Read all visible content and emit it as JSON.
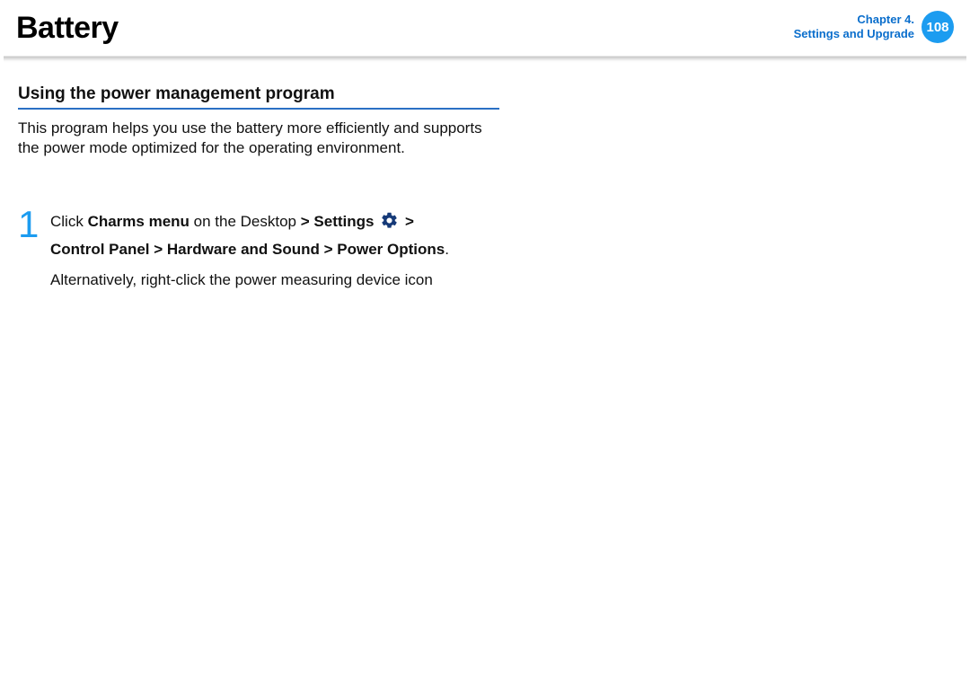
{
  "header": {
    "title": "Battery",
    "chapter_line1": "Chapter 4.",
    "chapter_line2": "Settings and Upgrade",
    "page_number": "108"
  },
  "section": {
    "heading": "Using the power management program",
    "intro": "This program helps you use the battery more efficiently and supports the power mode optimized for the operating environment."
  },
  "step": {
    "number": "1",
    "click_text": "Click ",
    "charms_menu": "Charms menu",
    "on_desktop": " on the Desktop ",
    "gt1": "> ",
    "settings": "Settings",
    "gt2": " > ",
    "control_panel": "Control Panel > Hardware and Sound > Power Options",
    "period": ".",
    "alt_text": "Alternatively, right-click the power measuring device icon"
  }
}
